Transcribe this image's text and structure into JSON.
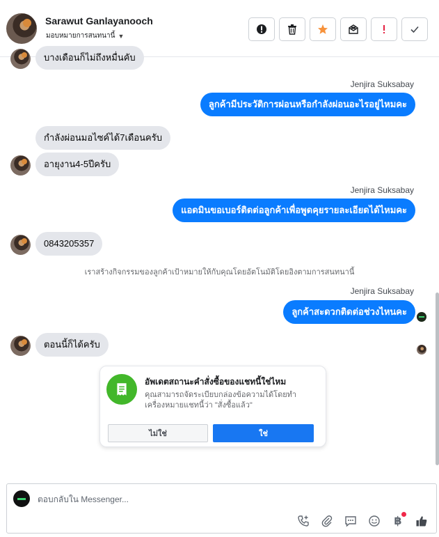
{
  "header": {
    "contact_name": "Sarawut Ganlayanooch",
    "assign_label": "มอบหมายการสนทนานี้",
    "tools": [
      {
        "name": "spam",
        "icon": "alert-circle-icon"
      },
      {
        "name": "delete",
        "icon": "trash-icon"
      },
      {
        "name": "star",
        "icon": "star-icon",
        "color": "#f7923b"
      },
      {
        "name": "mark-unread",
        "icon": "envelope-icon"
      },
      {
        "name": "follow-up",
        "icon": "exclamation-icon",
        "color": "#e41e3f"
      },
      {
        "name": "done",
        "icon": "check-icon"
      }
    ]
  },
  "conversation": {
    "messages": [
      {
        "side": "left",
        "text": "บางเดือนก็ไม่ถึงหมื่นคับ"
      },
      {
        "side": "right",
        "sender": "Jenjira Suksabay",
        "text": "ลูกค้ามีประวัติการผ่อนหรือกำลังผ่อนอะไรอยู่ไหมคะ"
      },
      {
        "side": "left",
        "text": "กำลังผ่อนมอไซค์ได้7เดือนครับ"
      },
      {
        "side": "left",
        "text": "อายุงาน4-5ปีครับ"
      },
      {
        "side": "right",
        "sender": "Jenjira Suksabay",
        "text": "แอดมินขอเบอร์ติดต่อลูกค้าเพื่อพูดคุยรายละเอียดได้ไหมคะ"
      },
      {
        "side": "left",
        "text": "0843205357"
      },
      {
        "side": "system",
        "text": "เราสร้างกิจกรรมของลูกค้าเป้าหมายให้กับคุณโดยอัตโนมัติโดยอิงตามการสนทนานี้"
      },
      {
        "side": "right",
        "sender": "Jenjira Suksabay",
        "text": "ลูกค้าสะดวกติดต่อช่วงไหนคะ"
      },
      {
        "side": "left",
        "text": "ตอนนี้ก็ได้ครับ"
      }
    ]
  },
  "order_card": {
    "title": "อัพเดตสถานะคำสั่งซื้อของแชทนี้ใช่ไหม",
    "description": "คุณสามารถจัดระเบียบกล่องข้อความได้โดยทำเครื่องหมายแชทนี้ว่า \"สั่งซื้อแล้ว\"",
    "no_label": "ไม่ใช่",
    "yes_label": "ใช่",
    "accent_color": "#42b72a"
  },
  "composer": {
    "placeholder": "ตอบกลับใน Messenger...",
    "currency_symbol": "฿",
    "icons": [
      "phone-add-icon",
      "paperclip-icon",
      "chat-bubble-icon",
      "smiley-icon",
      "baht-icon",
      "thumbs-up-icon"
    ]
  },
  "colors": {
    "outgoing_bubble": "#0a7cff",
    "incoming_bubble": "#e4e6eb",
    "primary_button": "#1877f2"
  }
}
